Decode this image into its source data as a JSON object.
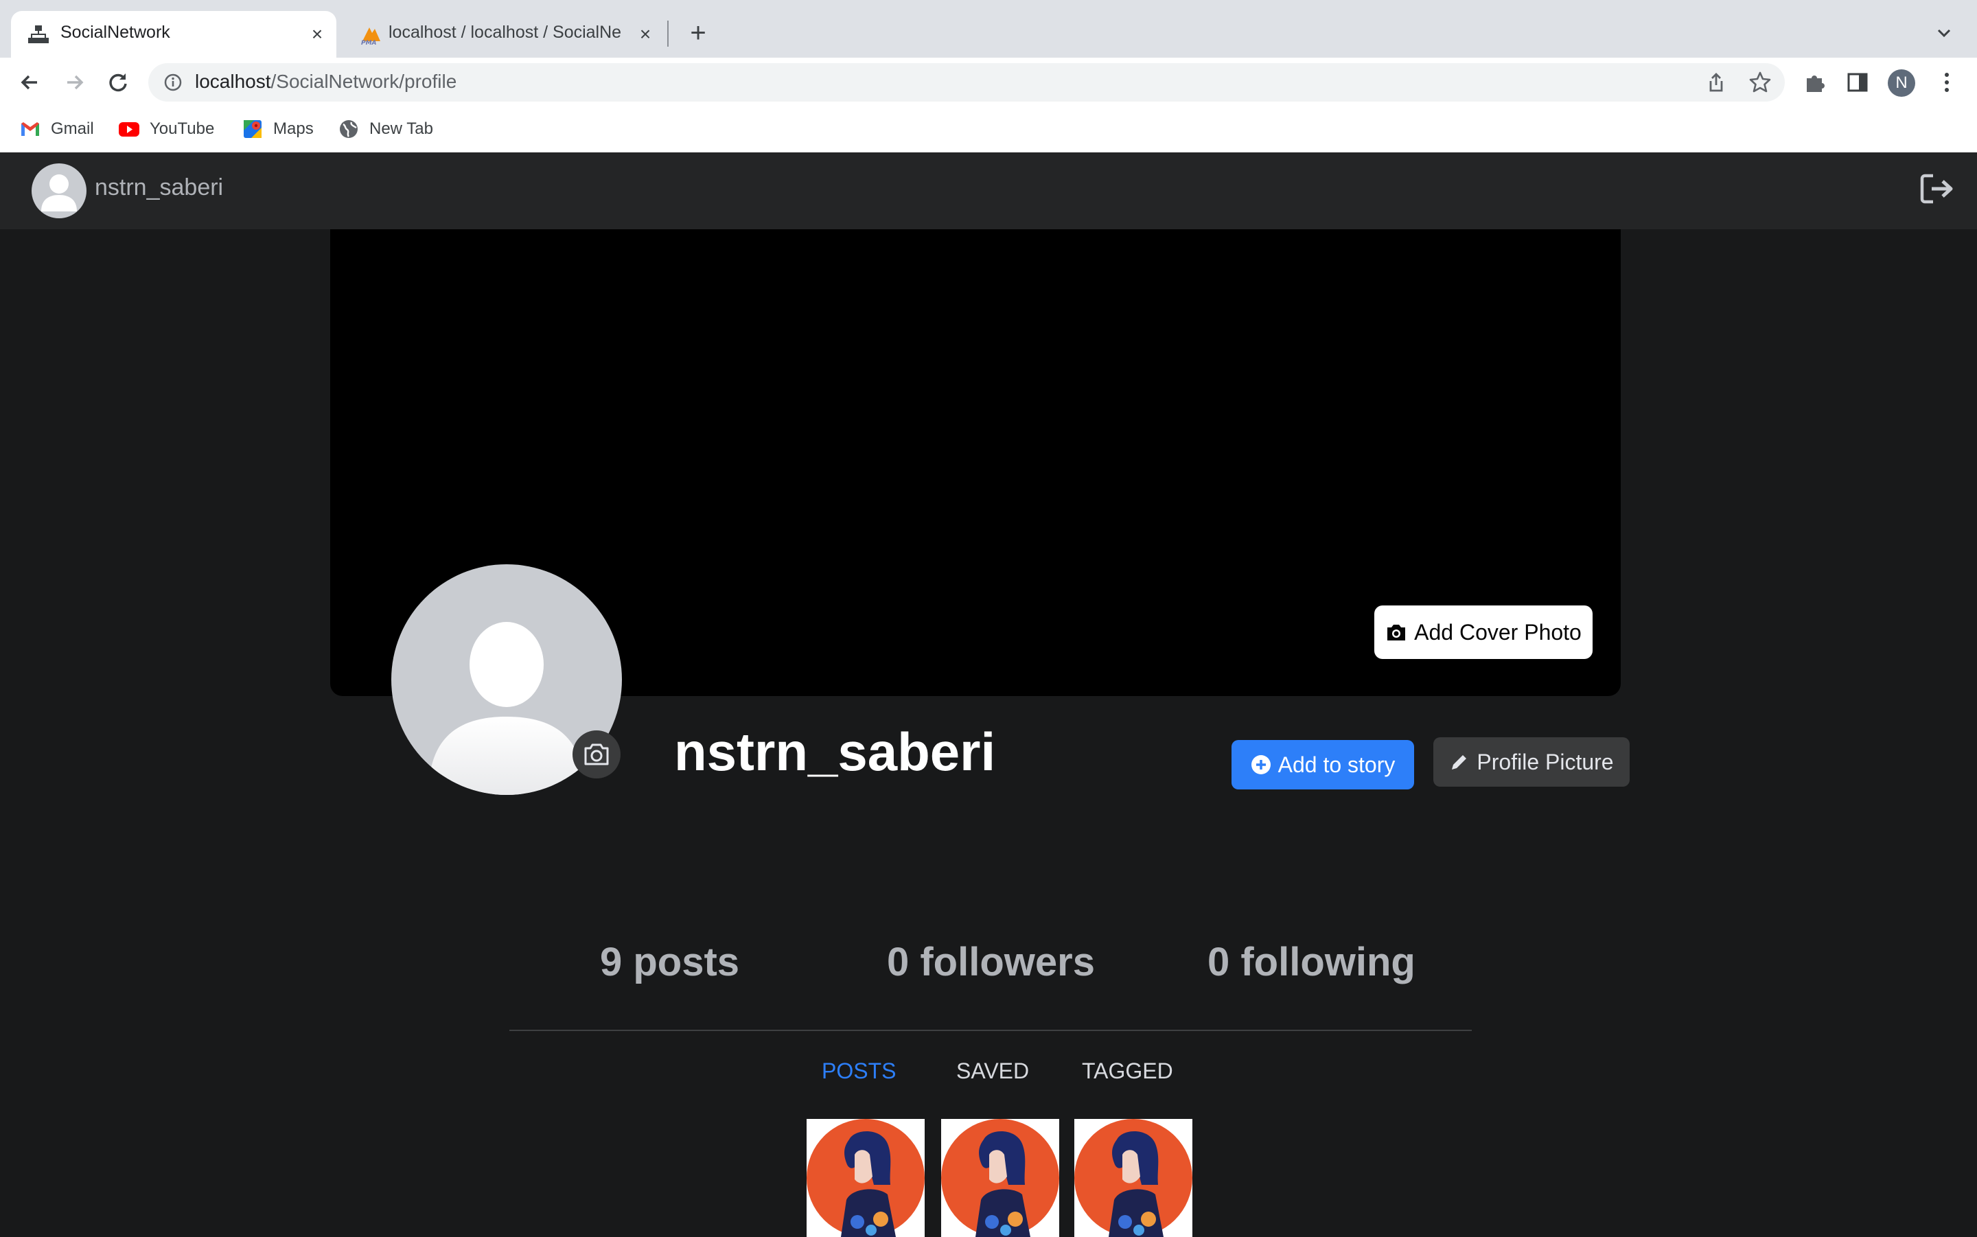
{
  "browser": {
    "tabs": [
      {
        "title": "SocialNetwork",
        "active": true,
        "favicon": "sitemap-icon"
      },
      {
        "title": "localhost / localhost / SocialNe",
        "active": false,
        "favicon": "phpmyadmin-icon"
      }
    ],
    "address": {
      "host": "localhost",
      "path": "/SocialNetwork/profile"
    },
    "profile_initial": "N",
    "bookmarks": [
      {
        "label": "Gmail",
        "icon": "gmail-icon"
      },
      {
        "label": "YouTube",
        "icon": "youtube-icon"
      },
      {
        "label": "Maps",
        "icon": "maps-icon"
      },
      {
        "label": "New Tab",
        "icon": "globe-icon"
      }
    ]
  },
  "navbar": {
    "username": "nstrn_saberi",
    "logout_icon": "sign-out-icon"
  },
  "cover": {
    "add_cover_label": "Add Cover Photo"
  },
  "profile": {
    "name": "nstrn_saberi",
    "add_story_label": "Add to story",
    "edit_picture_label": "Profile Picture"
  },
  "stats": {
    "posts": "9 posts",
    "followers": "0 followers",
    "following": "0 following"
  },
  "tabs": {
    "posts": "POSTS",
    "saved": "SAVED",
    "tagged": "TAGGED",
    "active": "posts"
  },
  "colors": {
    "page_bg": "#18191a",
    "navbar_bg": "#242526",
    "accent": "#2d7ff9",
    "post_thumb_orange": "#e8552b"
  }
}
